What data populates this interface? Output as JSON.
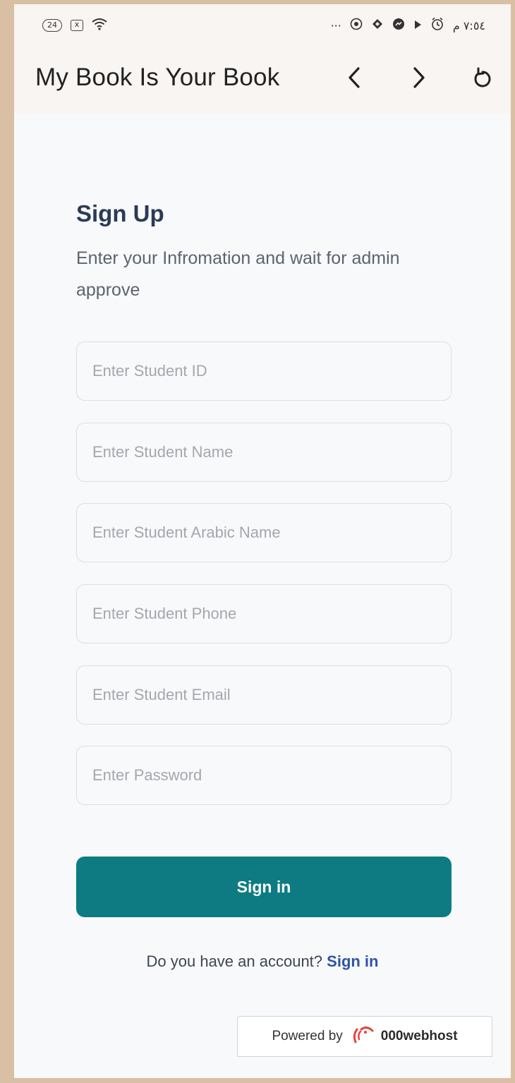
{
  "status_bar": {
    "badge": "24",
    "box_icon": "x",
    "dots": "···",
    "time": "٧:٥٤ م"
  },
  "app_bar": {
    "title": "My Book Is Your Book",
    "icons": [
      "chevron-left-icon",
      "chevron-right-icon",
      "refresh-icon"
    ]
  },
  "form": {
    "heading": "Sign Up",
    "subtitle": "Enter your Infromation and wait for admin approve",
    "fields": [
      {
        "placeholder": "Enter Student ID",
        "value": ""
      },
      {
        "placeholder": "Enter Student Name",
        "value": ""
      },
      {
        "placeholder": "Enter Student Arabic Name",
        "value": ""
      },
      {
        "placeholder": "Enter Student Phone",
        "value": ""
      },
      {
        "placeholder": "Enter Student Email",
        "value": ""
      },
      {
        "placeholder": "Enter Password",
        "value": ""
      }
    ],
    "submit_label": "Sign in",
    "account_prompt": "Do you have an account?",
    "account_link": "Sign in"
  },
  "footer": {
    "powered_by": "Powered by",
    "brand": "000webhost"
  },
  "colors": {
    "accent": "#0e7b83",
    "heading": "#2b3a57",
    "link": "#2f53a8",
    "backdrop": "#d9bfa3"
  }
}
